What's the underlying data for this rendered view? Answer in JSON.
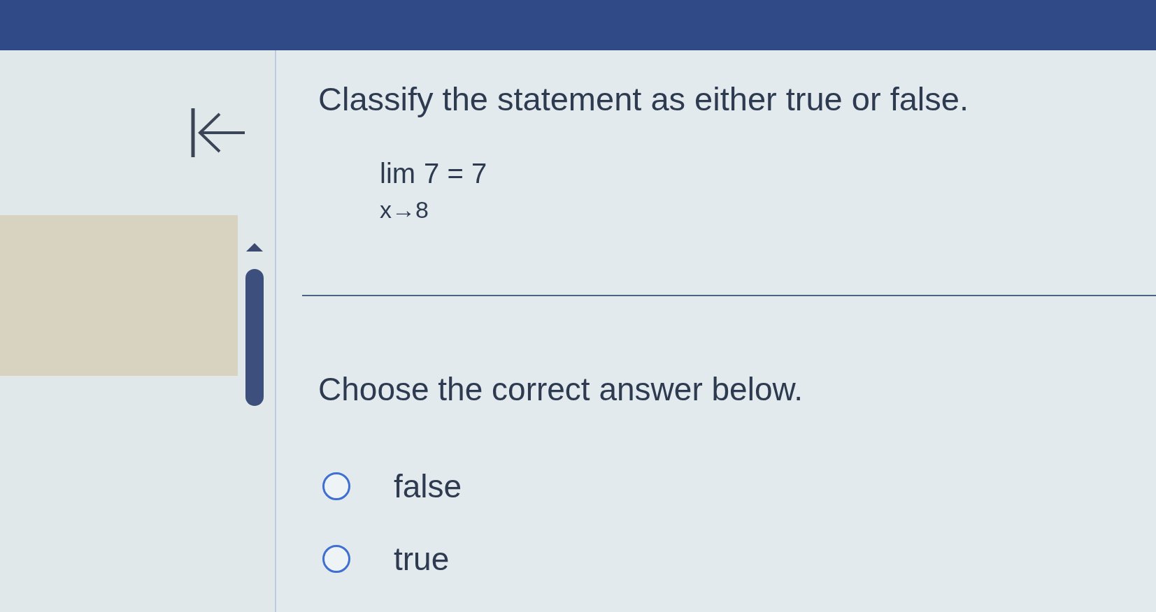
{
  "question": {
    "prompt": "Classify the statement as either true or false.",
    "expression": {
      "operator": "lim",
      "body": "7 = 7",
      "subscript": "x→8"
    }
  },
  "instruction": "Choose the correct answer below.",
  "options": [
    {
      "label": "false",
      "selected": false
    },
    {
      "label": "true",
      "selected": false
    }
  ]
}
